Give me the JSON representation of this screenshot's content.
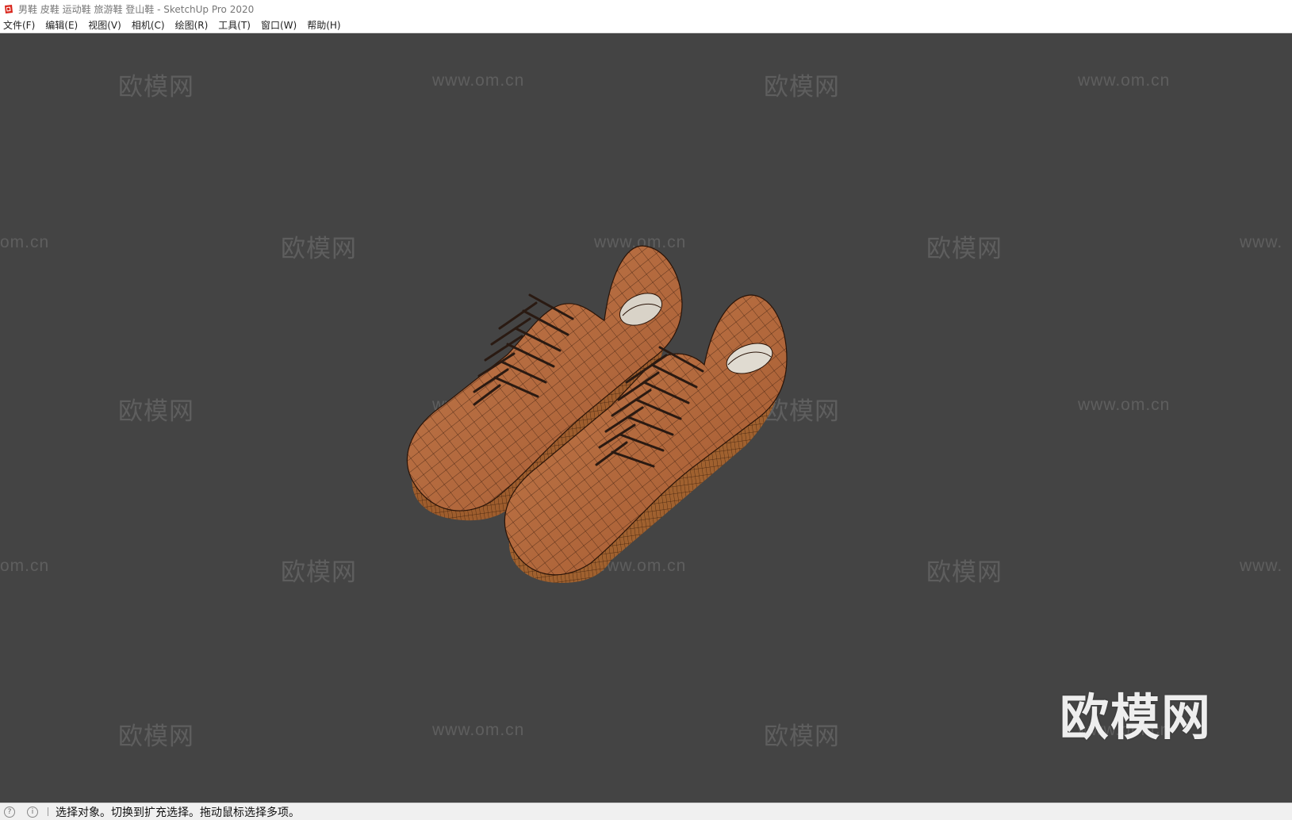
{
  "window": {
    "title": "男鞋 皮鞋 运动鞋 旅游鞋 登山鞋 - SketchUp Pro 2020"
  },
  "menu": [
    {
      "label": "文件(F)"
    },
    {
      "label": "编辑(E)"
    },
    {
      "label": "视图(V)"
    },
    {
      "label": "相机(C)"
    },
    {
      "label": "绘图(R)"
    },
    {
      "label": "工具(T)"
    },
    {
      "label": "窗口(W)"
    },
    {
      "label": "帮助(H)"
    }
  ],
  "watermarks": {
    "cn": "欧模网",
    "url": "www.om.cn",
    "url_left_cut": "om.cn",
    "url_right_cut": "www.",
    "big": "欧模网"
  },
  "status": {
    "text": "选择对象。切换到扩充选择。拖动鼠标选择多项。"
  },
  "colors": {
    "viewport_bg": "#444444",
    "leather": "#b0653c",
    "sole": "#a0612f",
    "mesh_line": "#2a1408"
  },
  "icons": [
    "sketchup-app-icon",
    "geo-location-icon",
    "info-icon"
  ]
}
